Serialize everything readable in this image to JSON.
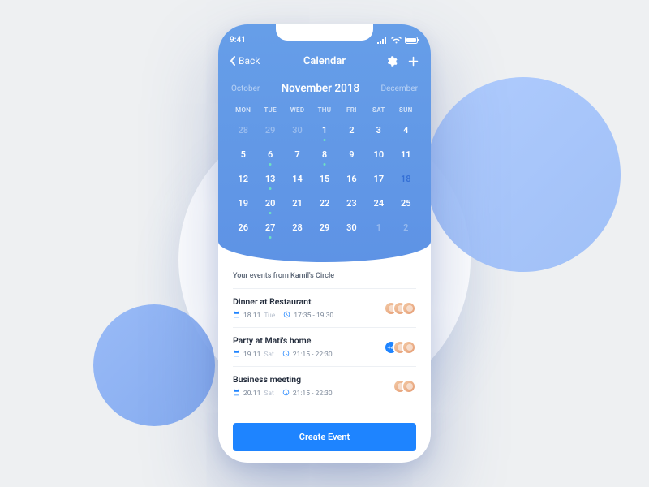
{
  "status": {
    "time": "9:41"
  },
  "nav": {
    "back_label": "Back",
    "title": "Calendar"
  },
  "months": {
    "prev": "October",
    "current": "November 2018",
    "next": "December"
  },
  "weekdays": [
    "MON",
    "TUE",
    "WED",
    "THU",
    "FRI",
    "SAT",
    "SUN"
  ],
  "calendar": {
    "rows": [
      [
        {
          "n": "28",
          "dim": true
        },
        {
          "n": "29",
          "dim": true
        },
        {
          "n": "30",
          "dim": true
        },
        {
          "n": "1",
          "dot": true
        },
        {
          "n": "2"
        },
        {
          "n": "3"
        },
        {
          "n": "4"
        }
      ],
      [
        {
          "n": "5"
        },
        {
          "n": "6",
          "dot": true
        },
        {
          "n": "7"
        },
        {
          "n": "8",
          "dot": true
        },
        {
          "n": "9"
        },
        {
          "n": "10"
        },
        {
          "n": "11"
        }
      ],
      [
        {
          "n": "12"
        },
        {
          "n": "13",
          "dot": true
        },
        {
          "n": "14"
        },
        {
          "n": "15"
        },
        {
          "n": "16"
        },
        {
          "n": "17"
        },
        {
          "n": "18",
          "selected": true
        }
      ],
      [
        {
          "n": "19"
        },
        {
          "n": "20",
          "dot": true
        },
        {
          "n": "21"
        },
        {
          "n": "22"
        },
        {
          "n": "23"
        },
        {
          "n": "24"
        },
        {
          "n": "25"
        }
      ],
      [
        {
          "n": "26"
        },
        {
          "n": "27",
          "dot": true
        },
        {
          "n": "28"
        },
        {
          "n": "29"
        },
        {
          "n": "30"
        },
        {
          "n": "1",
          "dim": true
        },
        {
          "n": "2",
          "dim": true
        }
      ]
    ]
  },
  "list": {
    "heading": "Your events from Kamil's Circle",
    "events": [
      {
        "title": "Dinner at Restaurant",
        "date": "18.11",
        "dow": "Tue",
        "time": "17:35 - 19:30",
        "overflow": null,
        "avatars": 3
      },
      {
        "title": "Party at Mati's home",
        "date": "19.11",
        "dow": "Sat",
        "time": "21:15 - 22:30",
        "overflow": "+4",
        "avatars": 2
      },
      {
        "title": "Business meeting",
        "date": "20.11",
        "dow": "Sat",
        "time": "21:15 - 22:30",
        "overflow": null,
        "avatars": 2
      }
    ]
  },
  "create_label": "Create Event",
  "colors": {
    "accent": "#1e84ff",
    "panel_top": "#669ee8"
  }
}
